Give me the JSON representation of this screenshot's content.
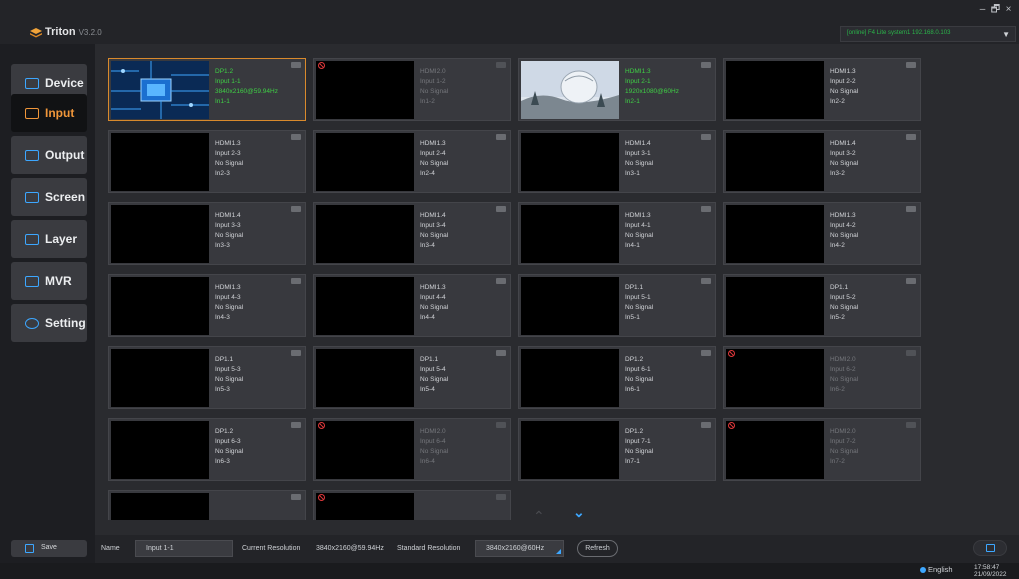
{
  "app": {
    "title": "Triton",
    "version": "V3.2.0"
  },
  "window_controls": [
    "–",
    "🗗",
    "×"
  ],
  "connection": {
    "status": "[online]",
    "device": "F4 Lite system1",
    "ip": "192.168.0.103",
    "text": "[online]   F4 Lite system1  192.168.0.103"
  },
  "sidebar": {
    "items": [
      {
        "label": "Device",
        "icon": "device-icon"
      },
      {
        "label": "Input",
        "icon": "input-icon",
        "active": true
      },
      {
        "label": "Output",
        "icon": "output-icon"
      },
      {
        "label": "Screen",
        "icon": "screen-icon"
      },
      {
        "label": "Layer",
        "icon": "layer-icon"
      },
      {
        "label": "MVR",
        "icon": "mvr-icon"
      },
      {
        "label": "Setting",
        "icon": "gear-icon"
      }
    ],
    "save_label": "Save"
  },
  "inputs": [
    {
      "port": "DP1.2",
      "name": "Input 1-1",
      "status": "3840x2160@59.94Hz",
      "id": "In1-1",
      "state": "active",
      "selected": true,
      "thumb": "circuit"
    },
    {
      "port": "HDMI2.0",
      "name": "Input 1-2",
      "status": "No Signal",
      "id": "In1-2",
      "state": "disabled"
    },
    {
      "port": "HDMI1.3",
      "name": "Input 2-1",
      "status": "1920x1080@60Hz",
      "id": "In2-1",
      "state": "active",
      "thumb": "dome"
    },
    {
      "port": "HDMI1.3",
      "name": "Input 2-2",
      "status": "No Signal",
      "id": "In2-2",
      "state": "normal"
    },
    {
      "port": "HDMI1.3",
      "name": "Input 2-3",
      "status": "No Signal",
      "id": "In2-3",
      "state": "normal"
    },
    {
      "port": "HDMI1.3",
      "name": "Input 2-4",
      "status": "No Signal",
      "id": "In2-4",
      "state": "normal"
    },
    {
      "port": "HDMI1.4",
      "name": "Input 3-1",
      "status": "No Signal",
      "id": "In3-1",
      "state": "normal"
    },
    {
      "port": "HDMI1.4",
      "name": "Input 3-2",
      "status": "No Signal",
      "id": "In3-2",
      "state": "normal"
    },
    {
      "port": "HDMI1.4",
      "name": "Input 3-3",
      "status": "No Signal",
      "id": "In3-3",
      "state": "normal"
    },
    {
      "port": "HDMI1.4",
      "name": "Input 3-4",
      "status": "No Signal",
      "id": "In3-4",
      "state": "normal"
    },
    {
      "port": "HDMI1.3",
      "name": "Input 4-1",
      "status": "No Signal",
      "id": "In4-1",
      "state": "normal"
    },
    {
      "port": "HDMI1.3",
      "name": "Input 4-2",
      "status": "No Signal",
      "id": "In4-2",
      "state": "normal"
    },
    {
      "port": "HDMI1.3",
      "name": "Input 4-3",
      "status": "No Signal",
      "id": "In4-3",
      "state": "normal"
    },
    {
      "port": "HDMI1.3",
      "name": "Input 4-4",
      "status": "No Signal",
      "id": "In4-4",
      "state": "normal"
    },
    {
      "port": "DP1.1",
      "name": "Input 5-1",
      "status": "No Signal",
      "id": "In5-1",
      "state": "normal"
    },
    {
      "port": "DP1.1",
      "name": "Input 5-2",
      "status": "No Signal",
      "id": "In5-2",
      "state": "normal"
    },
    {
      "port": "DP1.1",
      "name": "Input 5-3",
      "status": "No Signal",
      "id": "In5-3",
      "state": "normal"
    },
    {
      "port": "DP1.1",
      "name": "Input 5-4",
      "status": "No Signal",
      "id": "In5-4",
      "state": "normal"
    },
    {
      "port": "DP1.2",
      "name": "Input 6-1",
      "status": "No Signal",
      "id": "In6-1",
      "state": "normal"
    },
    {
      "port": "HDMI2.0",
      "name": "Input 6-2",
      "status": "No Signal",
      "id": "In6-2",
      "state": "disabled"
    },
    {
      "port": "DP1.2",
      "name": "Input 6-3",
      "status": "No Signal",
      "id": "In6-3",
      "state": "normal"
    },
    {
      "port": "HDMI2.0",
      "name": "Input 6-4",
      "status": "No Signal",
      "id": "In6-4",
      "state": "disabled"
    },
    {
      "port": "DP1.2",
      "name": "Input 7-1",
      "status": "No Signal",
      "id": "In7-1",
      "state": "normal"
    },
    {
      "port": "HDMI2.0",
      "name": "Input 7-2",
      "status": "No Signal",
      "id": "In7-2",
      "state": "disabled"
    },
    {
      "port": "",
      "name": "",
      "status": "",
      "id": "",
      "state": "normal",
      "partial": true
    },
    {
      "port": "",
      "name": "",
      "status": "",
      "id": "",
      "state": "disabled",
      "partial": true
    }
  ],
  "pager": {
    "up": "⌃",
    "down": "⌄"
  },
  "properties": {
    "name_label": "Name",
    "name_value": "Input 1-1",
    "current_resolution_label": "Current Resolution",
    "current_resolution_value": "3840x2160@59.94Hz",
    "standard_resolution_label": "Standard Resolution",
    "standard_resolution_value": "3840x2160@60Hz",
    "refresh_label": "Refresh"
  },
  "status": {
    "language": "English",
    "time": "17:58:47",
    "date": "21/09/2022"
  }
}
